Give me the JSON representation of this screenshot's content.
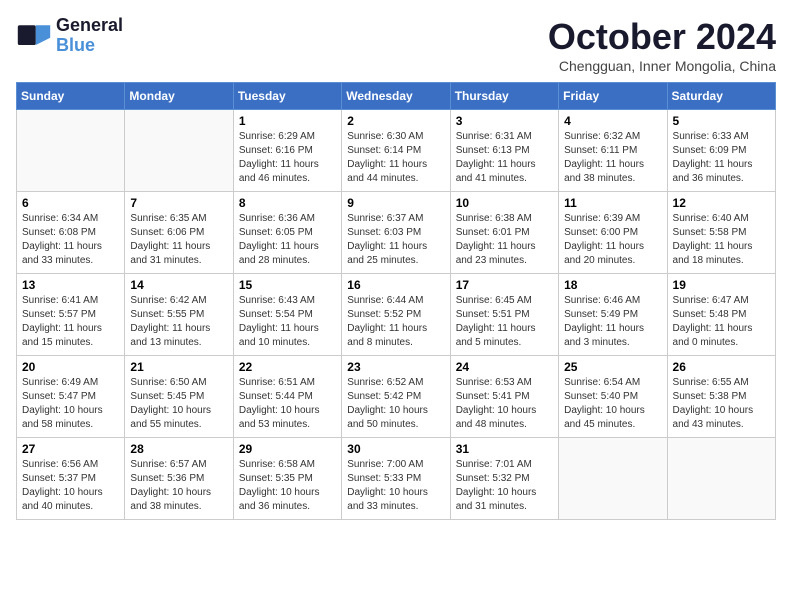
{
  "header": {
    "logo_line1": "General",
    "logo_line2": "Blue",
    "month_title": "October 2024",
    "location": "Chengguan, Inner Mongolia, China"
  },
  "days_of_week": [
    "Sunday",
    "Monday",
    "Tuesday",
    "Wednesday",
    "Thursday",
    "Friday",
    "Saturday"
  ],
  "weeks": [
    [
      {
        "day": "",
        "info": ""
      },
      {
        "day": "",
        "info": ""
      },
      {
        "day": "1",
        "info": "Sunrise: 6:29 AM\nSunset: 6:16 PM\nDaylight: 11 hours and 46 minutes."
      },
      {
        "day": "2",
        "info": "Sunrise: 6:30 AM\nSunset: 6:14 PM\nDaylight: 11 hours and 44 minutes."
      },
      {
        "day": "3",
        "info": "Sunrise: 6:31 AM\nSunset: 6:13 PM\nDaylight: 11 hours and 41 minutes."
      },
      {
        "day": "4",
        "info": "Sunrise: 6:32 AM\nSunset: 6:11 PM\nDaylight: 11 hours and 38 minutes."
      },
      {
        "day": "5",
        "info": "Sunrise: 6:33 AM\nSunset: 6:09 PM\nDaylight: 11 hours and 36 minutes."
      }
    ],
    [
      {
        "day": "6",
        "info": "Sunrise: 6:34 AM\nSunset: 6:08 PM\nDaylight: 11 hours and 33 minutes."
      },
      {
        "day": "7",
        "info": "Sunrise: 6:35 AM\nSunset: 6:06 PM\nDaylight: 11 hours and 31 minutes."
      },
      {
        "day": "8",
        "info": "Sunrise: 6:36 AM\nSunset: 6:05 PM\nDaylight: 11 hours and 28 minutes."
      },
      {
        "day": "9",
        "info": "Sunrise: 6:37 AM\nSunset: 6:03 PM\nDaylight: 11 hours and 25 minutes."
      },
      {
        "day": "10",
        "info": "Sunrise: 6:38 AM\nSunset: 6:01 PM\nDaylight: 11 hours and 23 minutes."
      },
      {
        "day": "11",
        "info": "Sunrise: 6:39 AM\nSunset: 6:00 PM\nDaylight: 11 hours and 20 minutes."
      },
      {
        "day": "12",
        "info": "Sunrise: 6:40 AM\nSunset: 5:58 PM\nDaylight: 11 hours and 18 minutes."
      }
    ],
    [
      {
        "day": "13",
        "info": "Sunrise: 6:41 AM\nSunset: 5:57 PM\nDaylight: 11 hours and 15 minutes."
      },
      {
        "day": "14",
        "info": "Sunrise: 6:42 AM\nSunset: 5:55 PM\nDaylight: 11 hours and 13 minutes."
      },
      {
        "day": "15",
        "info": "Sunrise: 6:43 AM\nSunset: 5:54 PM\nDaylight: 11 hours and 10 minutes."
      },
      {
        "day": "16",
        "info": "Sunrise: 6:44 AM\nSunset: 5:52 PM\nDaylight: 11 hours and 8 minutes."
      },
      {
        "day": "17",
        "info": "Sunrise: 6:45 AM\nSunset: 5:51 PM\nDaylight: 11 hours and 5 minutes."
      },
      {
        "day": "18",
        "info": "Sunrise: 6:46 AM\nSunset: 5:49 PM\nDaylight: 11 hours and 3 minutes."
      },
      {
        "day": "19",
        "info": "Sunrise: 6:47 AM\nSunset: 5:48 PM\nDaylight: 11 hours and 0 minutes."
      }
    ],
    [
      {
        "day": "20",
        "info": "Sunrise: 6:49 AM\nSunset: 5:47 PM\nDaylight: 10 hours and 58 minutes."
      },
      {
        "day": "21",
        "info": "Sunrise: 6:50 AM\nSunset: 5:45 PM\nDaylight: 10 hours and 55 minutes."
      },
      {
        "day": "22",
        "info": "Sunrise: 6:51 AM\nSunset: 5:44 PM\nDaylight: 10 hours and 53 minutes."
      },
      {
        "day": "23",
        "info": "Sunrise: 6:52 AM\nSunset: 5:42 PM\nDaylight: 10 hours and 50 minutes."
      },
      {
        "day": "24",
        "info": "Sunrise: 6:53 AM\nSunset: 5:41 PM\nDaylight: 10 hours and 48 minutes."
      },
      {
        "day": "25",
        "info": "Sunrise: 6:54 AM\nSunset: 5:40 PM\nDaylight: 10 hours and 45 minutes."
      },
      {
        "day": "26",
        "info": "Sunrise: 6:55 AM\nSunset: 5:38 PM\nDaylight: 10 hours and 43 minutes."
      }
    ],
    [
      {
        "day": "27",
        "info": "Sunrise: 6:56 AM\nSunset: 5:37 PM\nDaylight: 10 hours and 40 minutes."
      },
      {
        "day": "28",
        "info": "Sunrise: 6:57 AM\nSunset: 5:36 PM\nDaylight: 10 hours and 38 minutes."
      },
      {
        "day": "29",
        "info": "Sunrise: 6:58 AM\nSunset: 5:35 PM\nDaylight: 10 hours and 36 minutes."
      },
      {
        "day": "30",
        "info": "Sunrise: 7:00 AM\nSunset: 5:33 PM\nDaylight: 10 hours and 33 minutes."
      },
      {
        "day": "31",
        "info": "Sunrise: 7:01 AM\nSunset: 5:32 PM\nDaylight: 10 hours and 31 minutes."
      },
      {
        "day": "",
        "info": ""
      },
      {
        "day": "",
        "info": ""
      }
    ]
  ]
}
